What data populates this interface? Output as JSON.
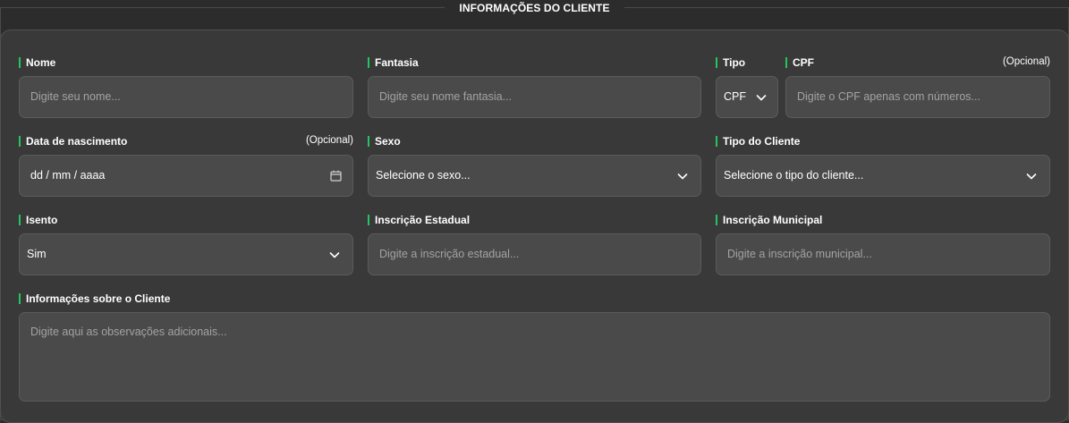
{
  "section_title": "INFORMAÇÕES DO CLIENTE",
  "fields": {
    "nome": {
      "label": "Nome",
      "placeholder": "Digite seu nome..."
    },
    "fantasia": {
      "label": "Fantasia",
      "placeholder": "Digite seu nome fantasia..."
    },
    "tipo": {
      "label": "Tipo",
      "value": "CPF"
    },
    "cpf": {
      "label": "CPF",
      "optional": "(Opcional)",
      "placeholder": "Digite o CPF apenas com números..."
    },
    "nascimento": {
      "label": "Data de nascimento",
      "optional": "(Opcional)",
      "value": "dd / mm / aaaa"
    },
    "sexo": {
      "label": "Sexo",
      "value": "Selecione o sexo..."
    },
    "tipo_cliente": {
      "label": "Tipo do Cliente",
      "value": "Selecione o tipo do cliente..."
    },
    "isento": {
      "label": "Isento",
      "value": "Sim"
    },
    "inscricao_estadual": {
      "label": "Inscrição Estadual",
      "placeholder": "Digite a inscrição estadual..."
    },
    "inscricao_municipal": {
      "label": "Inscrição Municipal",
      "placeholder": "Digite a inscrição municipal..."
    },
    "informacoes": {
      "label": "Informações sobre o Cliente",
      "placeholder": "Digite aqui as observações adicionais..."
    }
  },
  "colors": {
    "accent": "#22c55e",
    "background": "#2c2c2c",
    "panel": "#393939",
    "input": "#4a4a4a",
    "placeholder": "#a3a3a3"
  },
  "icons": {
    "select": "chevron-down-icon",
    "date": "calendar-icon"
  }
}
